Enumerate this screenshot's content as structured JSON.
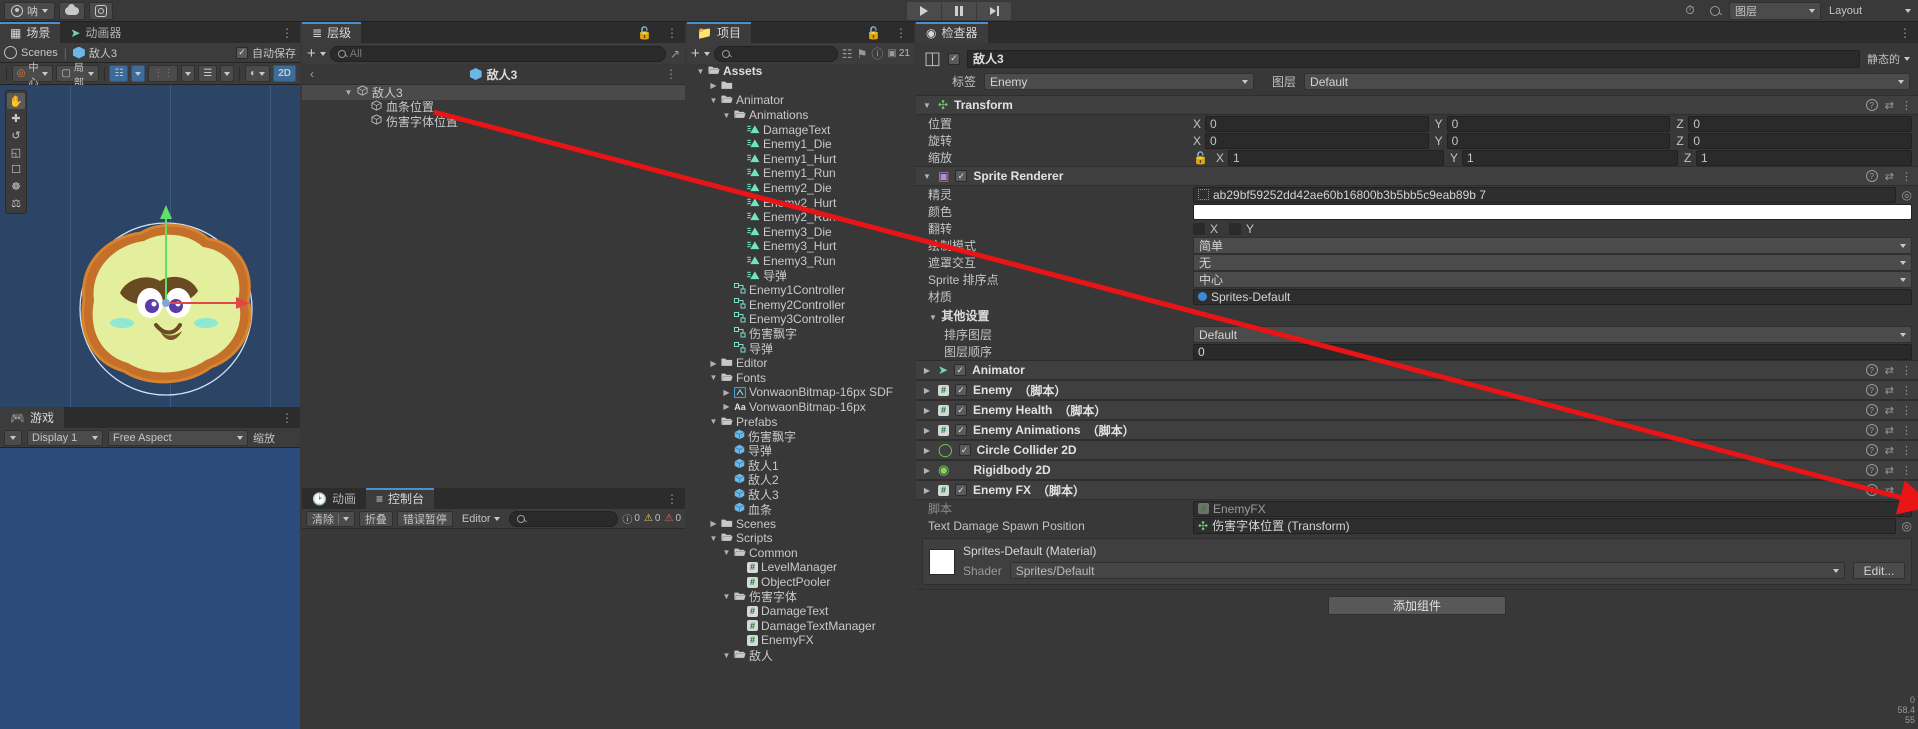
{
  "topbar": {
    "account_label": "呐",
    "cloud_icon": "cloud-icon",
    "settings_icon": "gear-icon",
    "play_icon": "play-icon",
    "pause_icon": "pause-icon",
    "step_icon": "step-icon",
    "collab_icon": "history-icon",
    "search_icon": "search-icon",
    "layers_label": "图层",
    "layout_label": "Layout"
  },
  "scene": {
    "tabs": [
      {
        "label": "场景",
        "icon": "grid-icon",
        "active": true
      },
      {
        "label": "动画器",
        "icon": "animator-icon",
        "active": false
      }
    ],
    "breadcrumb_scene": "Scenes",
    "breadcrumb_object": "敌人3",
    "autosave_label": "自动保存",
    "toolbar": {
      "pivot_label": "中心",
      "space_label": "局部",
      "mode_2d": "2D"
    },
    "left_tools": [
      "hand-tool",
      "move-tool",
      "rotate-tool",
      "scale-tool",
      "rect-tool",
      "transform-tool",
      "custom-tool"
    ]
  },
  "game": {
    "tab_label": "游戏",
    "display_label": "Display 1",
    "aspect_label": "Free Aspect",
    "scale_label": "缩放"
  },
  "hierarchy": {
    "tab_label": "层级",
    "search_placeholder": "All",
    "breadcrumb": "敌人3",
    "items": [
      {
        "label": "敌人3",
        "depth": 0,
        "expanded": true,
        "selected": true
      },
      {
        "label": "血条位置",
        "depth": 1,
        "expanded": false,
        "selected": false
      },
      {
        "label": "伤害字体位置",
        "depth": 1,
        "expanded": false,
        "selected": false
      }
    ]
  },
  "console": {
    "tabs": [
      {
        "label": "动画",
        "icon": "clock-icon",
        "active": false
      },
      {
        "label": "控制台",
        "icon": "console-icon",
        "active": true
      }
    ],
    "clear_label": "清除",
    "collapse_label": "折叠",
    "error_pause_label": "错误暂停",
    "editor_label": "Editor",
    "counts": {
      "info": "0",
      "warning": "0",
      "error": "0"
    }
  },
  "project": {
    "tab_label": "项目",
    "count_badge": "21",
    "items": [
      {
        "label": "Assets",
        "depth": 0,
        "icon": "folder-open-icon",
        "expanded": true,
        "bold": true
      },
      {
        "label": "",
        "depth": 1,
        "icon": "folder-icon",
        "expanded": false
      },
      {
        "label": "Animator",
        "depth": 1,
        "icon": "folder-open-icon",
        "expanded": true
      },
      {
        "label": "Animations",
        "depth": 2,
        "icon": "folder-open-icon",
        "expanded": true
      },
      {
        "label": "DamageText",
        "depth": 3,
        "icon": "animation-clip-icon"
      },
      {
        "label": "Enemy1_Die",
        "depth": 3,
        "icon": "animation-clip-icon"
      },
      {
        "label": "Enemy1_Hurt",
        "depth": 3,
        "icon": "animation-clip-icon"
      },
      {
        "label": "Enemy1_Run",
        "depth": 3,
        "icon": "animation-clip-icon"
      },
      {
        "label": "Enemy2_Die",
        "depth": 3,
        "icon": "animation-clip-icon"
      },
      {
        "label": "Enemy2_Hurt",
        "depth": 3,
        "icon": "animation-clip-icon"
      },
      {
        "label": "Enemy2_Run",
        "depth": 3,
        "icon": "animation-clip-icon"
      },
      {
        "label": "Enemy3_Die",
        "depth": 3,
        "icon": "animation-clip-icon"
      },
      {
        "label": "Enemy3_Hurt",
        "depth": 3,
        "icon": "animation-clip-icon"
      },
      {
        "label": "Enemy3_Run",
        "depth": 3,
        "icon": "animation-clip-icon"
      },
      {
        "label": "导弹",
        "depth": 3,
        "icon": "animation-clip-icon"
      },
      {
        "label": "Enemy1Controller",
        "depth": 2,
        "icon": "animator-controller-icon"
      },
      {
        "label": "Enemy2Controller",
        "depth": 2,
        "icon": "animator-controller-icon"
      },
      {
        "label": "Enemy3Controller",
        "depth": 2,
        "icon": "animator-controller-icon"
      },
      {
        "label": "伤害飘字",
        "depth": 2,
        "icon": "animator-controller-icon"
      },
      {
        "label": "导弹",
        "depth": 2,
        "icon": "animator-controller-icon"
      },
      {
        "label": "Editor",
        "depth": 1,
        "icon": "folder-icon",
        "expanded": false
      },
      {
        "label": "Fonts",
        "depth": 1,
        "icon": "folder-open-icon",
        "expanded": true
      },
      {
        "label": "VonwaonBitmap-16px SDF",
        "depth": 2,
        "icon": "font-asset-icon",
        "expanded": false
      },
      {
        "label": "VonwaonBitmap-16px",
        "depth": 2,
        "icon": "font-icon",
        "expanded": false
      },
      {
        "label": "Prefabs",
        "depth": 1,
        "icon": "folder-open-icon",
        "expanded": true
      },
      {
        "label": "伤害飘字",
        "depth": 2,
        "icon": "prefab-icon"
      },
      {
        "label": "导弹",
        "depth": 2,
        "icon": "prefab-icon"
      },
      {
        "label": "敌人1",
        "depth": 2,
        "icon": "prefab-icon"
      },
      {
        "label": "敌人2",
        "depth": 2,
        "icon": "prefab-icon"
      },
      {
        "label": "敌人3",
        "depth": 2,
        "icon": "prefab-icon"
      },
      {
        "label": "血条",
        "depth": 2,
        "icon": "prefab-icon"
      },
      {
        "label": "Scenes",
        "depth": 1,
        "icon": "folder-icon",
        "expanded": false
      },
      {
        "label": "Scripts",
        "depth": 1,
        "icon": "folder-open-icon",
        "expanded": true
      },
      {
        "label": "Common",
        "depth": 2,
        "icon": "folder-open-icon",
        "expanded": true
      },
      {
        "label": "LevelManager",
        "depth": 3,
        "icon": "script-icon"
      },
      {
        "label": "ObjectPooler",
        "depth": 3,
        "icon": "script-icon"
      },
      {
        "label": "伤害字体",
        "depth": 2,
        "icon": "folder-open-icon",
        "expanded": true
      },
      {
        "label": "DamageText",
        "depth": 3,
        "icon": "script-icon"
      },
      {
        "label": "DamageTextManager",
        "depth": 3,
        "icon": "script-icon"
      },
      {
        "label": "EnemyFX",
        "depth": 3,
        "icon": "script-icon"
      },
      {
        "label": "敌人",
        "depth": 2,
        "icon": "folder-open-icon",
        "expanded": true
      }
    ]
  },
  "inspector": {
    "tab_label": "检查器",
    "object_name": "敌人3",
    "static_label": "静态的",
    "tag_label": "标签",
    "tag_value": "Enemy",
    "layer_label": "图层",
    "layer_value": "Default",
    "transform": {
      "title": "Transform",
      "position_label": "位置",
      "rotation_label": "旋转",
      "scale_label": "缩放",
      "position": {
        "x": "0",
        "y": "0",
        "z": "0"
      },
      "rotation": {
        "x": "0",
        "y": "0",
        "z": "0"
      },
      "scale": {
        "x": "1",
        "y": "1",
        "z": "1"
      }
    },
    "sprite_renderer": {
      "title": "Sprite Renderer",
      "sprite_label": "精灵",
      "sprite_value": "ab29bf59252dd42ae60b16800b3b5bb5c9eab89b  7",
      "color_label": "颜色",
      "color_value": "#FFFFFF",
      "flip_label": "翻转",
      "flip_x_label": "X",
      "flip_y_label": "Y",
      "draw_mode_label": "绘制模式",
      "draw_mode_value": "简单",
      "mask_label": "遮罩交互",
      "mask_value": "无",
      "sort_point_label": "Sprite 排序点",
      "sort_point_value": "中心",
      "material_label": "材质",
      "material_value": "Sprites-Default",
      "other_settings_label": "其他设置",
      "sorting_layer_label": "排序图层",
      "sorting_layer_value": "Default",
      "order_label": "图层顺序",
      "order_value": "0"
    },
    "components": [
      {
        "title": "Animator",
        "icon": "animator-icon",
        "enabled": true,
        "script": false
      },
      {
        "title": "Enemy",
        "suffix": "（脚本）",
        "icon": "script-icon",
        "enabled": true,
        "script": true
      },
      {
        "title": "Enemy Health",
        "suffix": "（脚本）",
        "icon": "script-icon",
        "enabled": true,
        "script": true
      },
      {
        "title": "Enemy Animations",
        "suffix": "（脚本）",
        "icon": "script-icon",
        "enabled": true,
        "script": true
      },
      {
        "title": "Circle Collider 2D",
        "icon": "circle-collider-icon",
        "enabled": true,
        "script": false
      },
      {
        "title": "Rigidbody 2D",
        "icon": "rigidbody-icon",
        "enabled": null,
        "script": false
      },
      {
        "title": "Enemy FX",
        "suffix": "（脚本）",
        "icon": "script-icon",
        "enabled": true,
        "script": true
      }
    ],
    "enemy_fx": {
      "script_label": "脚本",
      "script_value": "EnemyFX",
      "spawn_label": "Text Damage Spawn Position",
      "spawn_value": "伤害字体位置 (Transform)"
    },
    "material_preview": {
      "title": "Sprites-Default (Material)",
      "shader_label": "Shader",
      "shader_value": "Sprites/Default"
    },
    "add_component_label": "添加组件",
    "footer_numbers": [
      "0",
      "58.4",
      "55"
    ]
  },
  "colors": {
    "accent_blue": "#4a8fd0",
    "panel_bg": "#383838",
    "arrow_red": "#e81416",
    "scene_bg": "#2c4566",
    "game_bg": "#2b4b7d"
  }
}
